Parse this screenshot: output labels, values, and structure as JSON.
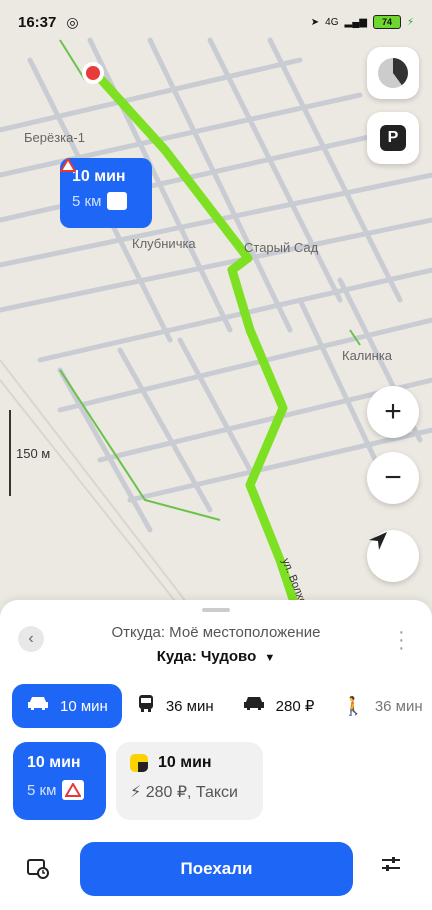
{
  "status_bar": {
    "time": "16:37",
    "network": "4G",
    "battery": "74"
  },
  "map": {
    "places": [
      "Берёзка-1",
      "Клубничка",
      "Старый Сад",
      "Калинка"
    ],
    "street": "ул. Волховстр",
    "scale_label": "150 м",
    "route_callout": {
      "time": "10 мин",
      "distance": "5 км"
    }
  },
  "map_controls": {
    "zoom_in": "+",
    "zoom_out": "−",
    "parking": "P"
  },
  "route_sheet": {
    "from_label": "Откуда: Моё местоположение",
    "to_label": "Куда: Чудово",
    "to_arrow": "▼",
    "modes": [
      {
        "name": "car",
        "label": "10 мин",
        "icon": "car-icon",
        "active": true
      },
      {
        "name": "bus",
        "label": "36 мин",
        "icon": "bus-icon",
        "active": false
      },
      {
        "name": "taxi",
        "label": "280 ₽",
        "icon": "taxi-icon",
        "active": false
      },
      {
        "name": "walk",
        "label": "36 мин",
        "icon": "walk-icon",
        "active": false
      }
    ],
    "selected_route": {
      "time": "10 мин",
      "distance": "5 км"
    },
    "taxi_option": {
      "time": "10 мин",
      "price": "280 ₽, Такси"
    },
    "go_button": "Поехали"
  },
  "colors": {
    "accent": "#1e66f5",
    "route": "#7ee023",
    "map_bg": "#ece9e2"
  }
}
